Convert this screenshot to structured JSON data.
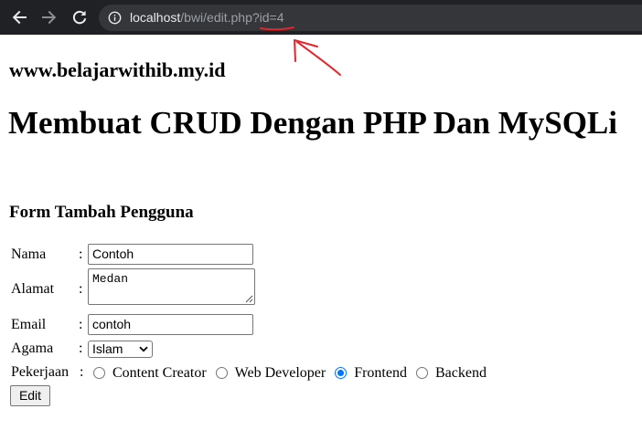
{
  "browser": {
    "url_host": "localhost",
    "url_path": "/bwi/edit.php?id=4"
  },
  "annotation_color": "#e8232a",
  "page": {
    "site_title": "www.belajarwithib.my.id",
    "heading": "Membuat CRUD Dengan PHP Dan MySQLi",
    "form_title": "Form Tambah Pengguna"
  },
  "form": {
    "separator": ":",
    "nama": {
      "label": "Nama",
      "value": "Contoh"
    },
    "alamat": {
      "label": "Alamat",
      "value": "Medan"
    },
    "email": {
      "label": "Email",
      "value": "contoh"
    },
    "agama": {
      "label": "Agama",
      "selected": "Islam"
    },
    "pekerjaan": {
      "label": "Pekerjaan",
      "options": [
        "Content Creator",
        "Web Developer",
        "Frontend",
        "Backend"
      ],
      "selected": "Frontend"
    },
    "submit_label": "Edit"
  },
  "icons": {
    "back": "arrow-left-icon",
    "forward": "arrow-right-icon",
    "reload": "reload-icon",
    "site_info": "info-icon",
    "select": "chevron-down-icon"
  }
}
